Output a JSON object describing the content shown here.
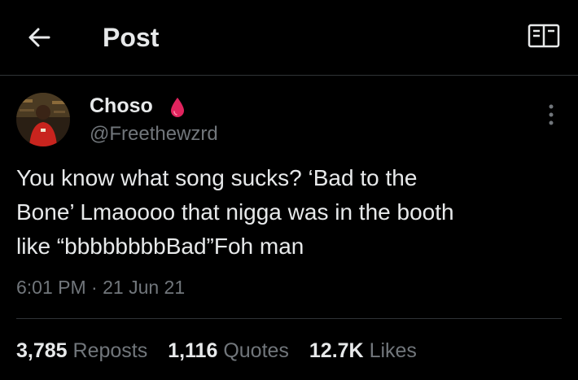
{
  "header": {
    "title": "Post",
    "back_icon": "arrow-left-icon",
    "reader_icon": "reader-mode-icon"
  },
  "author": {
    "name": "Choso",
    "handle": "@Freethewzrd",
    "badge_icon": "blood-drop-icon",
    "badge_color": "#e0245e"
  },
  "post": {
    "lines": [
      "You know what song sucks? ‘Bad to the",
      "Bone’ Lmaoooo that nigga was in the booth",
      "like “bbbbbbbbBad”Foh man"
    ],
    "timestamp": "6:01 PM · 21 Jun 21"
  },
  "stats": {
    "reposts_count": "3,785",
    "reposts_label": "Reposts",
    "quotes_count": "1,116",
    "quotes_label": "Quotes",
    "likes_count": "12.7K",
    "likes_label": "Likes"
  },
  "colors": {
    "background": "#000000",
    "text_primary": "#e7e9ea",
    "text_secondary": "#71767b",
    "divider": "#2f3336"
  }
}
